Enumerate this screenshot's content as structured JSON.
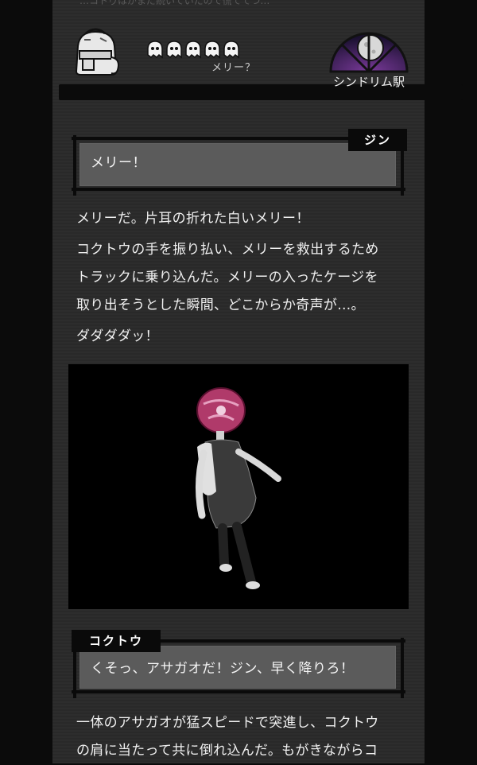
{
  "top_ghost_text": "…コトゥはがまだ続いていたので慌ててつ…",
  "header": {
    "inventory_icon": "backpack-icon",
    "lives": {
      "icon": "ghost-icon",
      "count": 5,
      "name": "メリー？"
    },
    "station": {
      "icon": "moon-window-icon",
      "label": "シンドリム駅"
    }
  },
  "dialog1": {
    "speaker": "ジン",
    "text": "メリー！"
  },
  "story1": [
    "メリーだ。片耳の折れた白いメリー！",
    "コクトウの手を振り払い、メリーを救出するため",
    "トラックに乗り込んだ。メリーの入ったケージを",
    "取り出そうとした瞬間、どこからか奇声が…。",
    "ダダダダッ！"
  ],
  "scene": {
    "description_icon": "asagao-monster-figure",
    "flower_color": "#b03a6a"
  },
  "dialog2": {
    "speaker": "コクトウ",
    "text": "くそっ、アサガオだ！ジン、早く降りろ！"
  },
  "story2": [
    "一体のアサガオが猛スピードで突進し、コクトウ",
    "の肩に当たって共に倒れ込んだ。もがきながらコ"
  ],
  "colors": {
    "background": "#0b0b0b",
    "panel": "#2a2a2a",
    "dialog_box": "#5b5b5b",
    "accent_flower": "#b03a6a",
    "station_sky": "#5a2a7a"
  }
}
